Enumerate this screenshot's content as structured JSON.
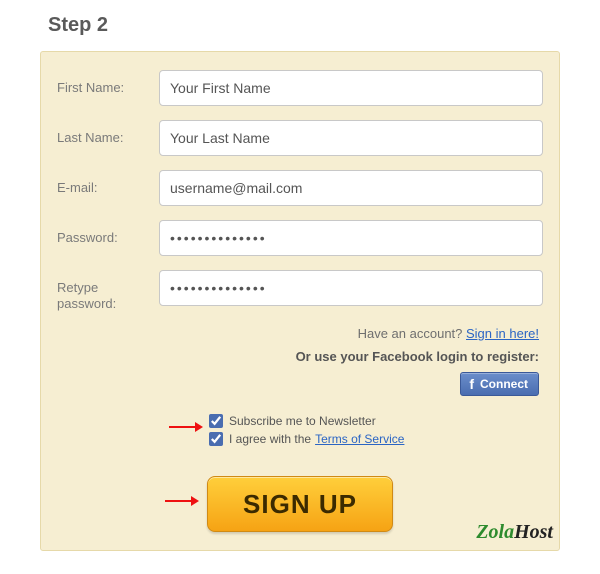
{
  "title": "Step 2",
  "fields": {
    "first_name": {
      "label": "First Name:",
      "placeholder": "Your First Name"
    },
    "last_name": {
      "label": "Last Name:",
      "placeholder": "Your Last Name"
    },
    "email": {
      "label": "E-mail:",
      "placeholder": "username@mail.com"
    },
    "password": {
      "label": "Password:",
      "value": "••••••••••••••"
    },
    "retype": {
      "label": "Retype password:",
      "value": "••••••••••••••"
    }
  },
  "have_account": {
    "text": "Have an account? ",
    "link": "Sign in here!"
  },
  "fb": {
    "prompt": "Or use your Facebook login to register:",
    "button": "Connect"
  },
  "checks": {
    "newsletter": "Subscribe me to Newsletter",
    "agree_prefix": "I agree with the",
    "tos_link": "Terms of Service"
  },
  "signup_label": "SIGN UP",
  "brand": {
    "part1": "Zola",
    "part2": "Host"
  }
}
